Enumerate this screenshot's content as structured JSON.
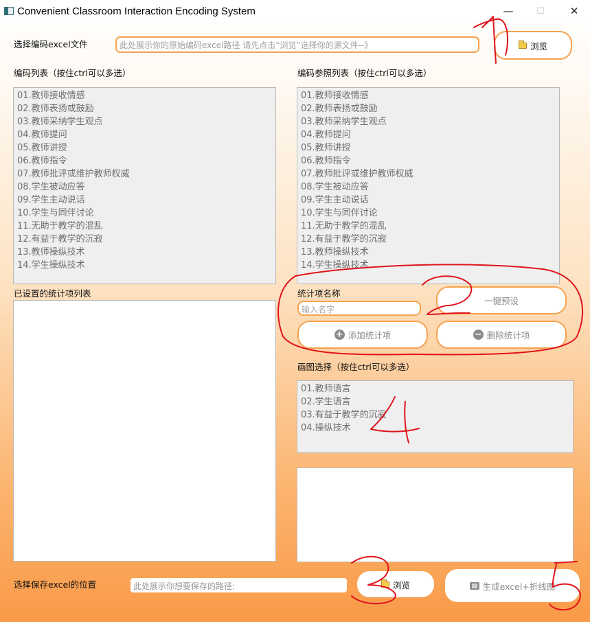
{
  "window": {
    "title": "Convenient Classroom Interaction Encoding System",
    "minimize_glyph": "—",
    "maximize_glyph": "☐",
    "close_glyph": "✕"
  },
  "source": {
    "label": "选择编码excel文件",
    "path_placeholder": "此处展示你的原始编码excel路径        请先点击“浏览”选择你的源文件--》",
    "browse_label": "浏览"
  },
  "code_list": {
    "label": "编码列表（按住ctrl可以多选）",
    "items": [
      "01.教师接收情感",
      "02.教师表扬或鼓励",
      "03.教师采纳学生观点",
      "04.教师提问",
      "05.教师讲授",
      "06.教师指令",
      "07.教师批评或维护教师权威",
      "08.学生被动应答",
      "09.学生主动说话",
      "10.学生与同伴讨论",
      "11.无助于教学的混乱",
      "12.有益于教学的沉寂",
      "13.教师操纵技术",
      "14.学生操纵技术"
    ]
  },
  "ref_list": {
    "label": "编码参照列表（按住ctrl可以多选）",
    "items": [
      "01.教师接收情感",
      "02.教师表扬或鼓励",
      "03.教师采纳学生观点",
      "04.教师提问",
      "05.教师讲授",
      "06.教师指令",
      "07.教师批评或维护教师权威",
      "08.学生被动应答",
      "09.学生主动说话",
      "10.学生与同伴讨论",
      "11.无助于教学的混乱",
      "12.有益于教学的沉寂",
      "13.教师操纵技术",
      "14.学生操纵技术"
    ]
  },
  "stats": {
    "list_label": "已设置的统计项列表",
    "name_label": "统计项名称",
    "name_placeholder": "输入名字",
    "preset_label": "一键预设",
    "add_label": "添加统计项",
    "remove_label": "删除统计项",
    "add_glyph": "+",
    "remove_glyph": "−"
  },
  "plot": {
    "label": "画图选择（按住ctrl可以多选）",
    "items": [
      "01.教师语言",
      "02.学生语言",
      "03.有益于教学的沉寂",
      "04.操纵技术"
    ]
  },
  "save": {
    "label": "选择保存excel的位置",
    "path_placeholder": "此处展示你想要保存的路径:",
    "browse_label": "浏览",
    "generate_label": "生成excel+折线图"
  },
  "annotations": {
    "color": "#e0141c",
    "marks": [
      "1",
      "2",
      "3",
      "4",
      "5"
    ]
  }
}
